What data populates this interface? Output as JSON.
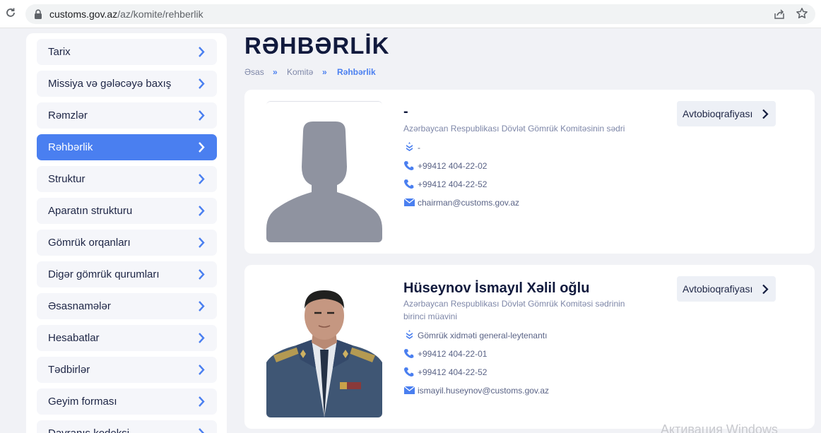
{
  "browser": {
    "url_host": "customs.gov.az",
    "url_path": "/az/komite/rehberlik"
  },
  "sidebar": {
    "items": [
      {
        "label": "Tarix"
      },
      {
        "label": "Missiya və gələcəyə baxış"
      },
      {
        "label": "Rəmzlər"
      },
      {
        "label": "Rəhbərlik",
        "active": true
      },
      {
        "label": "Struktur"
      },
      {
        "label": "Aparatın strukturu"
      },
      {
        "label": "Gömrük orqanları"
      },
      {
        "label": "Digər gömrük qurumları"
      },
      {
        "label": "Əsasnamələr"
      },
      {
        "label": "Hesabatlar"
      },
      {
        "label": "Tədbirlər"
      },
      {
        "label": "Geyim forması"
      },
      {
        "label": "Davranış kodeksi"
      }
    ]
  },
  "page": {
    "title": "RƏHBƏRLİK",
    "breadcrumb": {
      "home": "Əsas",
      "parent": "Komitə",
      "current": "Rəhbərlik",
      "separator": "»"
    }
  },
  "people": [
    {
      "name": "-",
      "position": "Azərbaycan Respublikası Dövlət Gömrük Komitəsinin sədri",
      "rank": "-",
      "phone1": "+99412 404-22-02",
      "phone2": "+99412 404-22-52",
      "email": "chairman@customs.gov.az",
      "bio_label": "Avtobioqrafiyası",
      "photo": "placeholder"
    },
    {
      "name": "Hüseynov İsmayıl Xəlil oğlu",
      "position": "Azərbaycan Respublikası Dövlət Gömrük Komitəsi sədrinin birinci müavini",
      "rank": "Gömrük xidməti general-leytenantı",
      "phone1": "+99412 404-22-01",
      "phone2": "+99412 404-22-52",
      "email": "ismayil.huseynov@customs.gov.az",
      "bio_label": "Avtobioqrafiyası",
      "photo": "portrait"
    }
  ],
  "overlay": {
    "watermark": "Активация Windows"
  },
  "icons": {
    "reload": "reload-icon",
    "lock": "lock-icon",
    "share": "share-icon",
    "star": "star-icon",
    "chevron": "chevron-right-icon",
    "rank": "rank-insignia-icon",
    "phone": "phone-icon",
    "email": "email-icon"
  },
  "colors": {
    "accent": "#4a7ff0",
    "title": "#111a3d",
    "muted": "#7e87a8",
    "background": "#f1f2f6",
    "card": "#ffffff"
  }
}
